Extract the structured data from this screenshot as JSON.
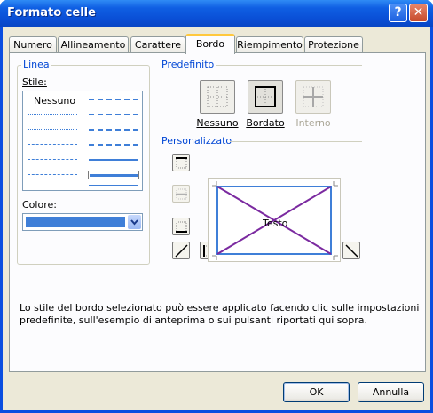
{
  "window": {
    "title": "Formato celle",
    "help_symbol": "?",
    "close_symbol": "✕"
  },
  "tabs": [
    {
      "label": "Numero"
    },
    {
      "label": "Allineamento"
    },
    {
      "label": "Carattere"
    },
    {
      "label": "Bordo"
    },
    {
      "label": "Riempimento"
    },
    {
      "label": "Protezione"
    }
  ],
  "active_tab": "Bordo",
  "line_group": {
    "title": "Linea",
    "style_label": "Stile:",
    "none_label": "Nessuno",
    "color_label": "Colore:",
    "selected_color": "#3f7fd8"
  },
  "presets": {
    "title": "Predefinito",
    "buttons": [
      {
        "label": "Nessuno",
        "icon": "border-none-icon",
        "enabled": true
      },
      {
        "label": "Bordato",
        "icon": "border-outline-icon",
        "enabled": true
      },
      {
        "label": "Interno",
        "icon": "border-inside-icon",
        "enabled": false
      }
    ]
  },
  "custom": {
    "title": "Personalizzato",
    "preview_text": "Testo",
    "buttons": [
      {
        "icon": "border-top-icon",
        "enabled": true
      },
      {
        "icon": "border-inside-horizontal-icon",
        "enabled": false
      },
      {
        "icon": "border-bottom-icon",
        "enabled": true
      },
      {
        "icon": "border-diagonal-up-icon",
        "enabled": true
      },
      {
        "icon": "border-left-icon",
        "enabled": true
      },
      {
        "icon": "border-inside-vertical-icon",
        "enabled": false
      },
      {
        "icon": "border-right-icon",
        "enabled": true
      },
      {
        "icon": "border-diagonal-down-icon",
        "enabled": true
      }
    ]
  },
  "description": "Lo stile del bordo selezionato può essere applicato facendo clic sulle impostazioni predefinite, sull'esempio di anteprima o sui pulsanti riportati qui sopra.",
  "buttons": {
    "ok": "OK",
    "cancel": "Annulla"
  },
  "colors": {
    "accent": "#0046d5",
    "border_line": "#3f7fd8",
    "diagonal": "#7b2aa0"
  }
}
